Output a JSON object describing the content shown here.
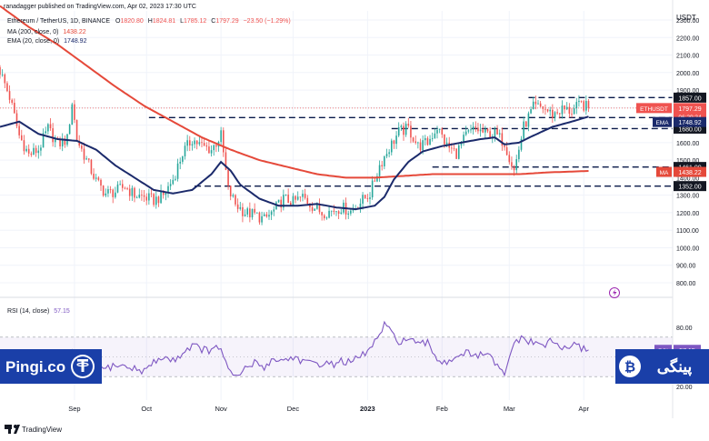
{
  "header": {
    "publisher": "ranadagger published on TradingView.com, Apr 02, 2023 17:30 UTC",
    "symbol_line": "Ethereum / TetherUS, 1D, BINANCE",
    "o_label": "O",
    "o_value": "1820.80",
    "h_label": "H",
    "h_value": "1824.81",
    "l_label": "L",
    "l_value": "1785.12",
    "c_label": "C",
    "c_value": "1797.29",
    "change_value": "−23.50 (−1.29%)",
    "ma_label": "MA (200, close, 0)",
    "ma_value": "1438.22",
    "ema_label": "EMA (20, close, 0)",
    "ema_value": "1748.92"
  },
  "rsi_header": {
    "label": "RSI (14, close)",
    "value": "57.15"
  },
  "branding": {
    "left_logo": "Pingi.co",
    "right_logo": "پینگی",
    "tradingview": "TradingView"
  },
  "colors": {
    "up": "#26a69a",
    "down": "#ef5350",
    "ema": "#1b2a6b",
    "ma": "#e5493a",
    "rsi": "#7e57c2",
    "levels": "#0a1a4a",
    "price_tag": "#ef5350",
    "lightning": "#9c27b0"
  },
  "chart_data": [
    {
      "type": "candlestick",
      "title": "Ethereum / TetherUS, 1D, BINANCE",
      "currency": "USDT",
      "y_ticks": [
        800,
        900,
        1000,
        1100,
        1200,
        1300,
        1400,
        1500,
        1600,
        1700,
        1800,
        1900,
        2000,
        2100,
        2200,
        2300
      ],
      "ylim": [
        760,
        2390
      ],
      "x_ticks": [
        "Sep",
        "Oct",
        "Nov",
        "Dec",
        "2023",
        "Feb",
        "Mar",
        "Apr"
      ],
      "x_tick_days": [
        31,
        61,
        92,
        122,
        153,
        184,
        212,
        243
      ],
      "xlim": [
        0,
        280
      ],
      "horizontal_levels": [
        {
          "value": 1857,
          "label": "1857.00",
          "x_start_day": 220
        },
        {
          "value": 1743,
          "label": "1743.00",
          "x_start_day": 62
        },
        {
          "value": 1461,
          "label": "1461.00",
          "x_start_day": 180
        },
        {
          "value": 1352,
          "label": "1352.00",
          "x_start_day": 81
        }
      ],
      "horizontal_level_1680": {
        "value": 1680,
        "label": "1680.00",
        "x_start_day": 163
      },
      "axis_tags": [
        {
          "text": "ETHUSDT",
          "value": 1797.29
        },
        {
          "text": "1797.29",
          "value": 1797.29
        },
        {
          "text": "06:29:34",
          "value": 1797.29
        },
        {
          "text": "EMA",
          "value": 1748.92
        },
        {
          "text": "1748.92",
          "value": 1748.92
        },
        {
          "text": "MA",
          "value": 1438.22
        },
        {
          "text": "1438.22",
          "value": 1438.22
        }
      ],
      "series": [
        {
          "name": "ETHUSDT",
          "kind": "ohlc_keypoints",
          "days": [
            0,
            4,
            8,
            12,
            16,
            20,
            24,
            28,
            30,
            32,
            36,
            40,
            44,
            48,
            52,
            56,
            60,
            64,
            68,
            72,
            76,
            80,
            84,
            88,
            92,
            95,
            98,
            102,
            106,
            110,
            114,
            118,
            122,
            126,
            130,
            134,
            138,
            142,
            146,
            150,
            154,
            158,
            162,
            166,
            170,
            174,
            178,
            182,
            186,
            190,
            194,
            198,
            202,
            206,
            210,
            214,
            218,
            222,
            226,
            230,
            234,
            238,
            242,
            245
          ],
          "closes": [
            2010,
            1860,
            1640,
            1530,
            1560,
            1680,
            1590,
            1620,
            1830,
            1620,
            1500,
            1380,
            1310,
            1320,
            1350,
            1300,
            1290,
            1270,
            1300,
            1390,
            1540,
            1620,
            1580,
            1560,
            1640,
            1330,
            1250,
            1200,
            1190,
            1160,
            1210,
            1280,
            1260,
            1290,
            1240,
            1200,
            1210,
            1230,
            1210,
            1260,
            1310,
            1470,
            1570,
            1660,
            1680,
            1580,
            1600,
            1690,
            1580,
            1540,
            1640,
            1680,
            1650,
            1650,
            1600,
            1440,
            1690,
            1800,
            1800,
            1760,
            1790,
            1780,
            1820,
            1797
          ]
        },
        {
          "name": "EMA (20, close, 0)",
          "days": [
            0,
            8,
            16,
            24,
            32,
            40,
            48,
            56,
            64,
            72,
            80,
            88,
            92,
            96,
            100,
            108,
            116,
            124,
            132,
            140,
            148,
            156,
            160,
            164,
            170,
            176,
            184,
            192,
            200,
            206,
            210,
            216,
            222,
            230,
            238,
            245
          ],
          "values": [
            1690,
            1720,
            1650,
            1620,
            1610,
            1560,
            1470,
            1400,
            1330,
            1310,
            1330,
            1420,
            1490,
            1440,
            1360,
            1280,
            1240,
            1240,
            1250,
            1230,
            1220,
            1240,
            1290,
            1390,
            1490,
            1550,
            1580,
            1600,
            1620,
            1630,
            1590,
            1600,
            1640,
            1690,
            1720,
            1748.92
          ]
        },
        {
          "name": "MA (200, close, 0)",
          "days": [
            0,
            12,
            24,
            36,
            48,
            60,
            72,
            84,
            96,
            108,
            120,
            132,
            144,
            156,
            168,
            180,
            192,
            204,
            216,
            228,
            245
          ],
          "values": [
            2380,
            2260,
            2160,
            2040,
            1920,
            1810,
            1720,
            1630,
            1560,
            1500,
            1460,
            1420,
            1400,
            1400,
            1410,
            1420,
            1420,
            1420,
            1420,
            1430,
            1438.22
          ]
        }
      ]
    },
    {
      "type": "line",
      "title": "RSI (14, close)",
      "y_ticks": [
        80,
        60,
        40,
        20
      ],
      "ylim": [
        18,
        85
      ],
      "bands": [
        70,
        30
      ],
      "xlim": [
        0,
        280
      ],
      "series": [
        {
          "name": "RSI (14, close)",
          "days": [
            0,
            4,
            8,
            12,
            16,
            20,
            24,
            28,
            30,
            32,
            36,
            40,
            44,
            48,
            52,
            56,
            60,
            64,
            68,
            72,
            76,
            80,
            84,
            88,
            92,
            95,
            98,
            102,
            106,
            110,
            114,
            118,
            122,
            126,
            130,
            134,
            138,
            142,
            146,
            150,
            154,
            158,
            160,
            163,
            166,
            170,
            174,
            178,
            182,
            186,
            190,
            194,
            198,
            202,
            206,
            210,
            214,
            218,
            222,
            226,
            230,
            234,
            238,
            242,
            245
          ],
          "values": [
            52,
            38,
            34,
            40,
            46,
            44,
            36,
            48,
            56,
            40,
            34,
            36,
            38,
            42,
            40,
            38,
            36,
            44,
            50,
            46,
            54,
            62,
            58,
            56,
            60,
            36,
            28,
            38,
            44,
            40,
            48,
            46,
            50,
            46,
            42,
            44,
            42,
            46,
            44,
            50,
            58,
            72,
            82,
            74,
            66,
            68,
            62,
            64,
            48,
            44,
            52,
            54,
            50,
            54,
            44,
            30,
            66,
            68,
            64,
            62,
            66,
            58,
            62,
            59,
            57.15
          ]
        }
      ]
    }
  ]
}
